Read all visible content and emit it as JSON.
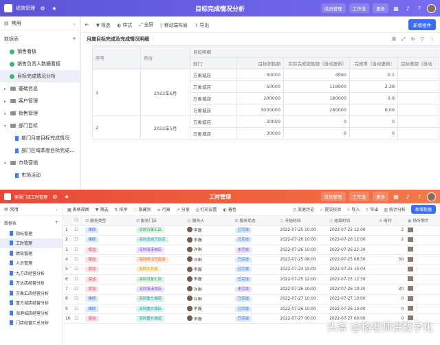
{
  "app1": {
    "header": {
      "title": "绩效管理",
      "center_title": "目标完成情况分析",
      "btn_member": "成员管理",
      "btn_workbench": "工作流",
      "btn_more": "更多"
    },
    "sidebar": {
      "space": "常用",
      "section": "数据表",
      "items": [
        {
          "label": "销售看板"
        },
        {
          "label": "销售负责人数据看板"
        },
        {
          "label": "目标完成情况分析"
        },
        {
          "label": "基础信息"
        },
        {
          "label": "客户管理"
        },
        {
          "label": "销售管理"
        },
        {
          "label": "部门目标"
        },
        {
          "label": "部门月度目标完成情况"
        },
        {
          "label": "部门区域季度目标完成..."
        },
        {
          "label": "市场营销"
        },
        {
          "label": "市场活动"
        }
      ]
    },
    "toolbar": {
      "filter": "筛选",
      "style": "样式",
      "fullscreen": "全屏",
      "move_layout": "移动端布局",
      "export": "导出",
      "new_btn": "新增组件"
    },
    "report": {
      "title": "月度目标完成及完成情况明细",
      "head_group": "目标明细",
      "cols": [
        "序号",
        "月份",
        "部门",
        "目标销售额",
        "实际完成销售额（自动更新）",
        "完成率（自动更新）",
        "目标差额（自动"
      ],
      "groups": [
        {
          "seq": "1",
          "month": "2022年6月",
          "rows": [
            [
              "万象城店",
              "50000",
              "4990",
              "0.1"
            ],
            [
              "万象城店",
              "50000",
              "118900",
              "2.38"
            ],
            [
              "万象城店",
              "200000",
              "180000",
              "0.9"
            ],
            [
              "万象城店",
              "3000000",
              "280000",
              "0.09"
            ]
          ]
        },
        {
          "seq": "2",
          "month": "2022年5月",
          "rows": [
            [
              "万象城店",
              "30000",
              "0",
              "0"
            ],
            [
              "万象城店",
              "30000",
              "0",
              "0"
            ]
          ]
        }
      ]
    }
  },
  "app2": {
    "header": {
      "title": "客服门店工时管理",
      "center_title": "工时管理",
      "btn_member": "成员管理",
      "btn_workbench": "工作流",
      "btn_more": "更多"
    },
    "sidebar": {
      "space": "常用",
      "section": "数据表",
      "items": [
        "指标管理",
        "工时管理",
        "绩效管理",
        "人员管理",
        "九方店经营分析",
        "万达店经营分析",
        "万象汇店经营分析",
        "重方城店经营分析",
        "海港城店经营分析",
        "门店经营汇总分析"
      ]
    },
    "toolbar": {
      "view": "表格视图",
      "filter": "筛选",
      "sort": "排序",
      "hide": "隐藏列",
      "row_height": "行高",
      "share": "分享",
      "print": "打印设置",
      "color": "着色",
      "history": "变更历史",
      "submit": "提交校验",
      "import": "导入",
      "export": "导出",
      "stats": "统计分析",
      "new_btn": "新增数据"
    },
    "columns": [
      "服务类型",
      "服务门店",
      "服务人",
      "服务状态",
      "开始时间",
      "结束时间",
      "用时",
      "场所照片"
    ],
    "rows": [
      {
        "n": "1",
        "type": "维修",
        "tc": "t-blue",
        "store": "深圳万象汇店",
        "sc": "t-green",
        "person": "李磊",
        "status": "已完成",
        "stc": "t-blue",
        "start": "2022-07-25 10:00",
        "end": "2022-07-25 12:00",
        "dur": "2"
      },
      {
        "n": "2",
        "type": "维修",
        "tc": "t-blue",
        "store": "深圳龙岗万达店",
        "sc": "t-teal",
        "person": "李磊",
        "status": "已完成",
        "stc": "t-blue",
        "start": "2022-07-26 10:00",
        "end": "2022-07-26 12:00",
        "dur": "2"
      },
      {
        "n": "3",
        "type": "保洁",
        "tc": "t-pink",
        "store": "深圳海港城店",
        "sc": "t-purple",
        "person": "许琳",
        "status": "未完成",
        "stc": "t-purple",
        "start": "2022-07-26 10:00",
        "end": "2022-07-26 22:30",
        "dur": ""
      },
      {
        "n": "4",
        "type": "保洁",
        "tc": "t-pink",
        "store": "深圳坪山万达店",
        "sc": "t-orange",
        "person": "许琳",
        "status": "已完成",
        "stc": "t-blue",
        "start": "2022-07-25 08:00",
        "end": "2022-07-25 08:30",
        "dur": "30"
      },
      {
        "n": "5",
        "type": "保洁",
        "tc": "t-pink",
        "store": "深圳九方店",
        "sc": "t-yellow",
        "person": "李磊",
        "status": "已完成",
        "stc": "t-blue",
        "start": "2022-07-24 15:00",
        "end": "2022-07-25 15:04",
        "dur": ""
      },
      {
        "n": "6",
        "type": "保洁",
        "tc": "t-pink",
        "store": "深圳万象汇店",
        "sc": "t-green",
        "person": "李磊",
        "status": "已完成",
        "stc": "t-blue",
        "start": "2022-07-25 12:00",
        "end": "2022-07-25 12:30",
        "dur": ""
      },
      {
        "n": "7",
        "type": "保洁",
        "tc": "t-pink",
        "store": "深圳海港城店",
        "sc": "t-purple",
        "person": "许琳",
        "status": "未完成",
        "stc": "t-purple",
        "start": "2022-07-26 10:00",
        "end": "2022-07-26 10:30",
        "dur": "30"
      },
      {
        "n": "8",
        "type": "维修",
        "tc": "t-blue",
        "store": "深圳重方城店",
        "sc": "t-teal",
        "person": "许琳",
        "status": "已完成",
        "stc": "t-blue",
        "start": "2022-07-27 10:00",
        "end": "2022-07-27 10:00",
        "dur": "0"
      },
      {
        "n": "9",
        "type": "维修",
        "tc": "t-blue",
        "store": "深圳重方城店",
        "sc": "t-teal",
        "person": "李磊",
        "status": "已完成",
        "stc": "t-blue",
        "start": "2022-07-26 10:00",
        "end": "2022-07-26 10:00",
        "dur": "0"
      },
      {
        "n": "10",
        "type": "保洁",
        "tc": "t-pink",
        "store": "深圳重方城店",
        "sc": "t-teal",
        "person": "李磊",
        "status": "已完成",
        "stc": "t-blue",
        "start": "2022-07-27 00:00",
        "end": "2022-07-27 00:00",
        "dur": "0"
      }
    ]
  },
  "watermark": "头条 @格老师讲数字化"
}
